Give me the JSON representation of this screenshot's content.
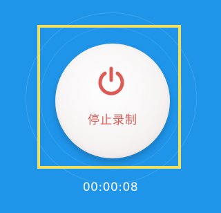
{
  "recording": {
    "stop_label": "停止录制",
    "button_icon": "power-icon",
    "elapsed_time": "00:00:08"
  },
  "colors": {
    "background": "#1f95ea",
    "highlight": "#f4dd58",
    "accent": "#de5a54",
    "button_face": "#f7f4f4"
  }
}
